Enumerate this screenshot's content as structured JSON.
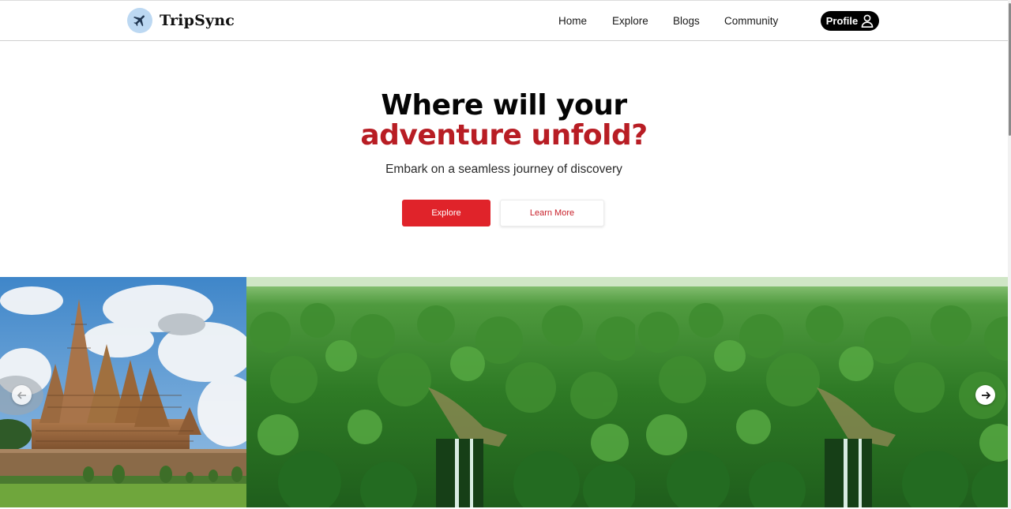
{
  "brand": {
    "name": "TripSync",
    "icon": "airplane-icon",
    "icon_bg": "#bcd8f2"
  },
  "nav": {
    "links": [
      {
        "label": "Home"
      },
      {
        "label": "Explore"
      },
      {
        "label": "Blogs"
      },
      {
        "label": "Community"
      }
    ],
    "profile_label": "Profile",
    "profile_icon": "user-icon"
  },
  "hero": {
    "title_line1": "Where will your",
    "title_line2": "adventure unfold?",
    "subtitle": "Embark on a seamless journey of discovery",
    "primary_button": "Explore",
    "secondary_button": "Learn More",
    "accent_color": "#b81d24",
    "button_color": "#e0232a"
  },
  "carousel": {
    "slides": [
      {
        "scene": "temple"
      },
      {
        "scene": "forest-waterfall"
      },
      {
        "scene": "forest-waterfall"
      }
    ],
    "prev_icon": "arrow-left-icon",
    "next_icon": "arrow-right-icon"
  }
}
